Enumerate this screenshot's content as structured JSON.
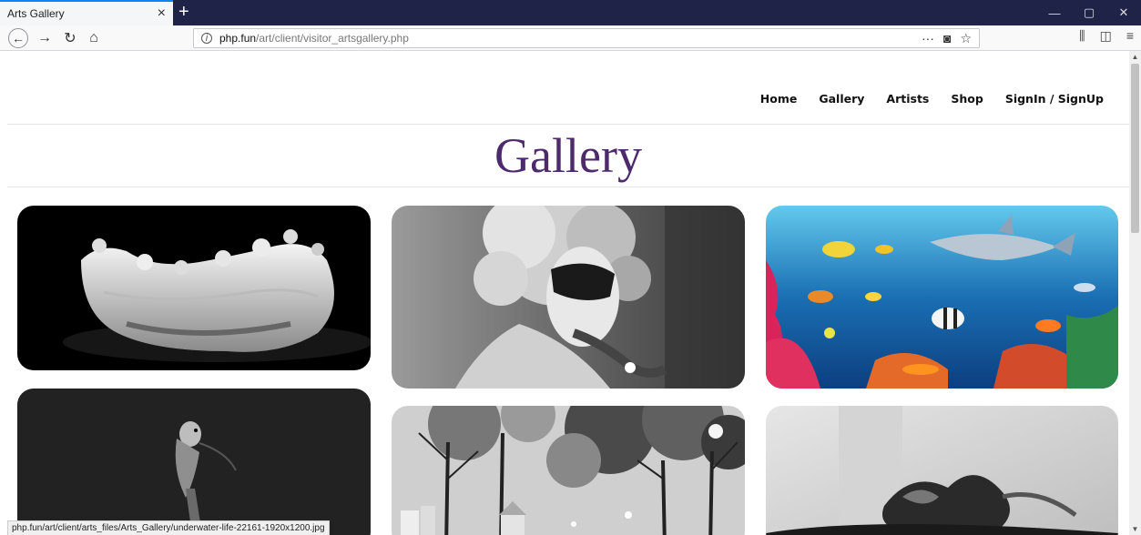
{
  "browser": {
    "tab_title": "Arts Gallery",
    "tab_close": "×",
    "new_tab": "+",
    "url_host": "php.fun",
    "url_path": "/art/client/visitor_artsgallery.php",
    "window_controls": [
      "—",
      "▢",
      "✕"
    ],
    "status_url": "php.fun/art/client/arts_files/Arts_Gallery/underwater-life-22161-1920x1200.jpg"
  },
  "nav": {
    "items": [
      "Home",
      "Gallery",
      "Artists",
      "Shop",
      "SignIn / SignUp"
    ]
  },
  "page": {
    "title": "Gallery"
  },
  "gallery": {
    "images": [
      {
        "subject": "milk-splash-crown"
      },
      {
        "subject": "masked-woman"
      },
      {
        "subject": "underwater-life"
      },
      {
        "subject": "parrot-on-dark"
      },
      {
        "subject": "painted-trees-town"
      },
      {
        "subject": "abstract-ink"
      }
    ]
  },
  "colors": {
    "title": "#4c2a6b",
    "tabbar": "#1f2347",
    "accent": "#0a84ff"
  }
}
